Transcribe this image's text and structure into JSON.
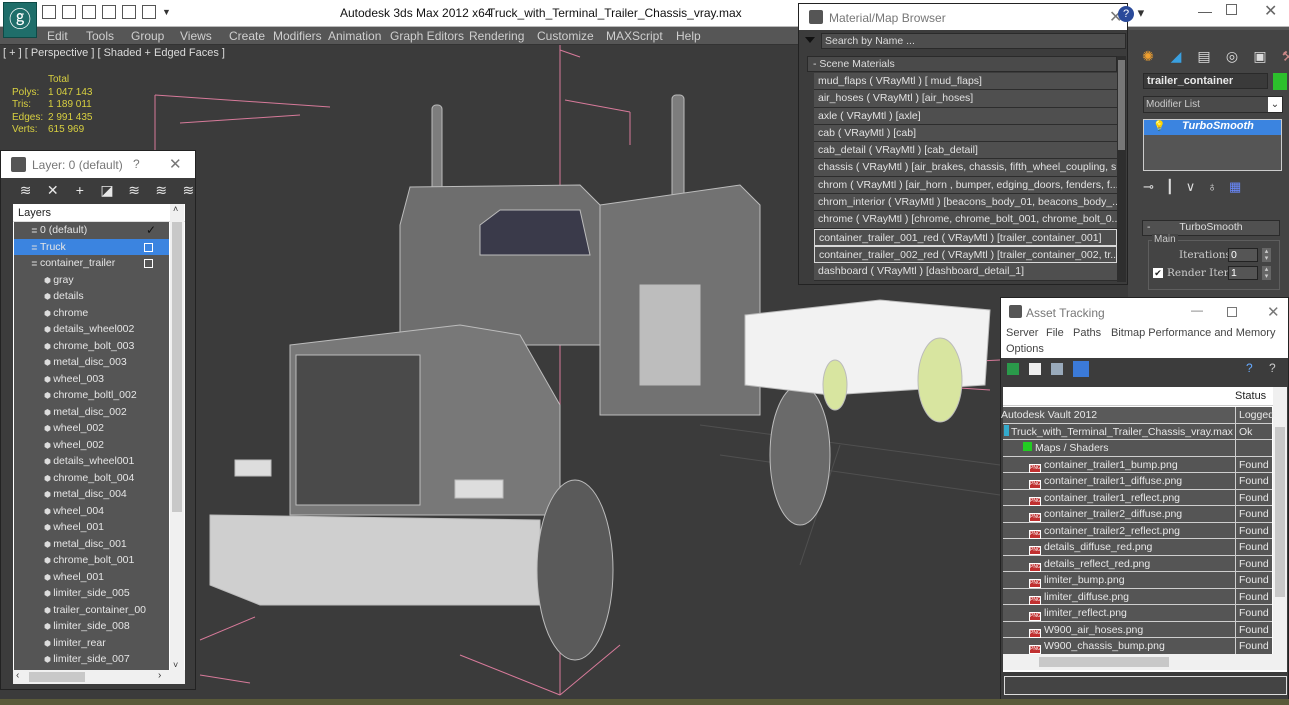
{
  "titlebar": {
    "app_title": "Autodesk 3ds Max  2012 x64",
    "doc_title": "Truck_with_Terminal_Trailer_Chassis_vray.max",
    "logo_icon": "3ds-max-logo-icon",
    "quick_access": [
      "open-icon",
      "save-icon",
      "new-icon",
      "hold-icon",
      "undo-icon",
      "redo-icon",
      "dropdown-icon"
    ]
  },
  "menu": [
    "Edit",
    "Tools",
    "Group",
    "Views",
    "Create",
    "Modifiers",
    "Animation",
    "Graph Editors",
    "Rendering",
    "Customize",
    "MAXScript",
    "Help"
  ],
  "viewport": {
    "label": "[ + ] [ Perspective ] [ Shaded + Edged Faces ]",
    "stats": {
      "header": "Total",
      "rows": [
        {
          "k": "Polys:",
          "v": "1 047 143"
        },
        {
          "k": "Tris:",
          "v": "1 189 011"
        },
        {
          "k": "Edges:",
          "v": "2 991 435"
        },
        {
          "k": "Verts:",
          "v": "615 969"
        }
      ]
    }
  },
  "layer_panel": {
    "title": "Layer: 0 (default)",
    "help": "?",
    "close": "✕",
    "tools": [
      "create-layer-icon",
      "delete-layer-icon",
      "add-to-layer-icon",
      "select-objects-icon",
      "select-layer-icon",
      "highlight-layer-icon",
      "hide-all-icon"
    ],
    "column_header": "Layers",
    "rows": [
      {
        "label": "0 (default)",
        "type": "layer",
        "indent": 1,
        "mark": "check"
      },
      {
        "label": "Truck",
        "type": "layer",
        "indent": 1,
        "mark": "box",
        "selected": true
      },
      {
        "label": "container_trailer",
        "type": "layer",
        "indent": 1,
        "mark": "box"
      },
      {
        "label": "gray",
        "type": "object"
      },
      {
        "label": "details",
        "type": "object"
      },
      {
        "label": "chrome",
        "type": "object"
      },
      {
        "label": "details_wheel002",
        "type": "object"
      },
      {
        "label": "chrome_bolt_003",
        "type": "object"
      },
      {
        "label": "metal_disc_003",
        "type": "object"
      },
      {
        "label": "wheel_003",
        "type": "object"
      },
      {
        "label": "chrome_boltl_002",
        "type": "object"
      },
      {
        "label": "metal_disc_002",
        "type": "object"
      },
      {
        "label": "wheel_002",
        "type": "object"
      },
      {
        "label": "wheel_002",
        "type": "object"
      },
      {
        "label": "details_wheel001",
        "type": "object"
      },
      {
        "label": "chrome_bolt_004",
        "type": "object"
      },
      {
        "label": "metal_disc_004",
        "type": "object"
      },
      {
        "label": "wheel_004",
        "type": "object"
      },
      {
        "label": "wheel_001",
        "type": "object"
      },
      {
        "label": "metal_disc_001",
        "type": "object"
      },
      {
        "label": "chrome_bolt_001",
        "type": "object"
      },
      {
        "label": "wheel_001",
        "type": "object"
      },
      {
        "label": "limiter_side_005",
        "type": "object"
      },
      {
        "label": "trailer_container_00",
        "type": "object"
      },
      {
        "label": "limiter_side_008",
        "type": "object"
      },
      {
        "label": "limiter_rear",
        "type": "object"
      },
      {
        "label": "limiter_side_007",
        "type": "object"
      }
    ]
  },
  "material_browser": {
    "title": "Material/Map Browser",
    "close": "✕",
    "search_placeholder": "Search by Name ...",
    "section": "- Scene Materials",
    "items": [
      {
        "label": " mud_flaps  ( VRayMtl ) [ mud_flaps]"
      },
      {
        "label": "air_hoses  ( VRayMtl ) [air_hoses]"
      },
      {
        "label": "axle  ( VRayMtl ) [axle]"
      },
      {
        "label": "cab  ( VRayMtl ) [cab]"
      },
      {
        "label": "cab_detail  ( VRayMtl ) [cab_detail]"
      },
      {
        "label": "chassis  ( VRayMtl ) [air_brakes, chassis, fifth_wheel_coupling, s..."
      },
      {
        "label": "chrom  ( VRayMtl ) [air_horn , bumper, edging_doors, fenders, f..."
      },
      {
        "label": "chrom_interior  ( VRayMtl ) [beacons_body_01, beacons_body_..."
      },
      {
        "label": "chrome  ( VRayMtl )  [chrome, chrome_bolt_001, chrome_bolt_0..."
      },
      {
        "label": "container_trailer_001_red  ( VRayMtl ) [trailer_container_001]",
        "highlighted": true
      },
      {
        "label": "container_trailer_002_red  ( VRayMtl ) [trailer_container_002, tr...",
        "highlighted": true
      },
      {
        "label": "dashboard  ( VRayMtl ) [dashboard_detail_1]"
      }
    ]
  },
  "command_panel": {
    "tabs": [
      "create-icon",
      "modify-icon",
      "hierarchy-icon",
      "motion-icon",
      "display-icon",
      "utilities-icon"
    ],
    "object_name": "trailer_container",
    "object_color": "#2cc02c",
    "modifier_list": "Modifier List",
    "stack": [
      {
        "label": "TurboSmooth",
        "active": true
      }
    ],
    "stack_tools": [
      "pin-stack-icon",
      "show-end-result-icon",
      "make-unique-icon",
      "remove-modifier-icon",
      "configure-sets-icon"
    ],
    "rollout_title": "TurboSmooth",
    "group_label": "Main",
    "iterations_label": "Iterations:",
    "iterations_value": "0",
    "render_iters_label": "Render Iters:",
    "render_iters_value": "1",
    "render_iters_checked": true
  },
  "window_controls": {
    "help": "?",
    "minimize": "—",
    "close": "✕"
  },
  "asset_tracking": {
    "title": "Asset Tracking",
    "minimize": "—",
    "close": "✕",
    "menu": [
      "Server",
      "File",
      "Paths",
      "Bitmap Performance and Memory",
      "Options"
    ],
    "toolbar": [
      "refresh-icon",
      "list-view-icon",
      "thumbnail-view-icon",
      "table-view-icon",
      "help-icon",
      "info-icon"
    ],
    "status_header": "Status",
    "rows": [
      {
        "name": "Autodesk Vault 2012",
        "status": "Logged",
        "level": 0
      },
      {
        "name": "Truck_with_Terminal_Trailer_Chassis_vray.max",
        "status": "Ok",
        "level": 0,
        "icon": "max-file-icon"
      },
      {
        "name": "Maps / Shaders",
        "status": "",
        "level": 1,
        "icon": "maps-folder-icon"
      },
      {
        "name": "container_trailer1_bump.png",
        "status": "Found",
        "level": 2,
        "icon": "png-icon"
      },
      {
        "name": "container_trailer1_diffuse.png",
        "status": "Found",
        "level": 2,
        "icon": "png-icon"
      },
      {
        "name": "container_trailer1_reflect.png",
        "status": "Found",
        "level": 2,
        "icon": "png-icon"
      },
      {
        "name": "container_trailer2_diffuse.png",
        "status": "Found",
        "level": 2,
        "icon": "png-icon"
      },
      {
        "name": "container_trailer2_reflect.png",
        "status": "Found",
        "level": 2,
        "icon": "png-icon"
      },
      {
        "name": "details_diffuse_red.png",
        "status": "Found",
        "level": 2,
        "icon": "png-icon"
      },
      {
        "name": "details_reflect_red.png",
        "status": "Found",
        "level": 2,
        "icon": "png-icon"
      },
      {
        "name": "limiter_bump.png",
        "status": "Found",
        "level": 2,
        "icon": "png-icon"
      },
      {
        "name": "limiter_diffuse.png",
        "status": "Found",
        "level": 2,
        "icon": "png-icon"
      },
      {
        "name": "limiter_reflect.png",
        "status": "Found",
        "level": 2,
        "icon": "png-icon"
      },
      {
        "name": "W900_air_hoses.png",
        "status": "Found",
        "level": 2,
        "icon": "png-icon"
      },
      {
        "name": "W900_chassis_bump.png",
        "status": "Found",
        "level": 2,
        "icon": "png-icon"
      }
    ],
    "path_value": ""
  }
}
